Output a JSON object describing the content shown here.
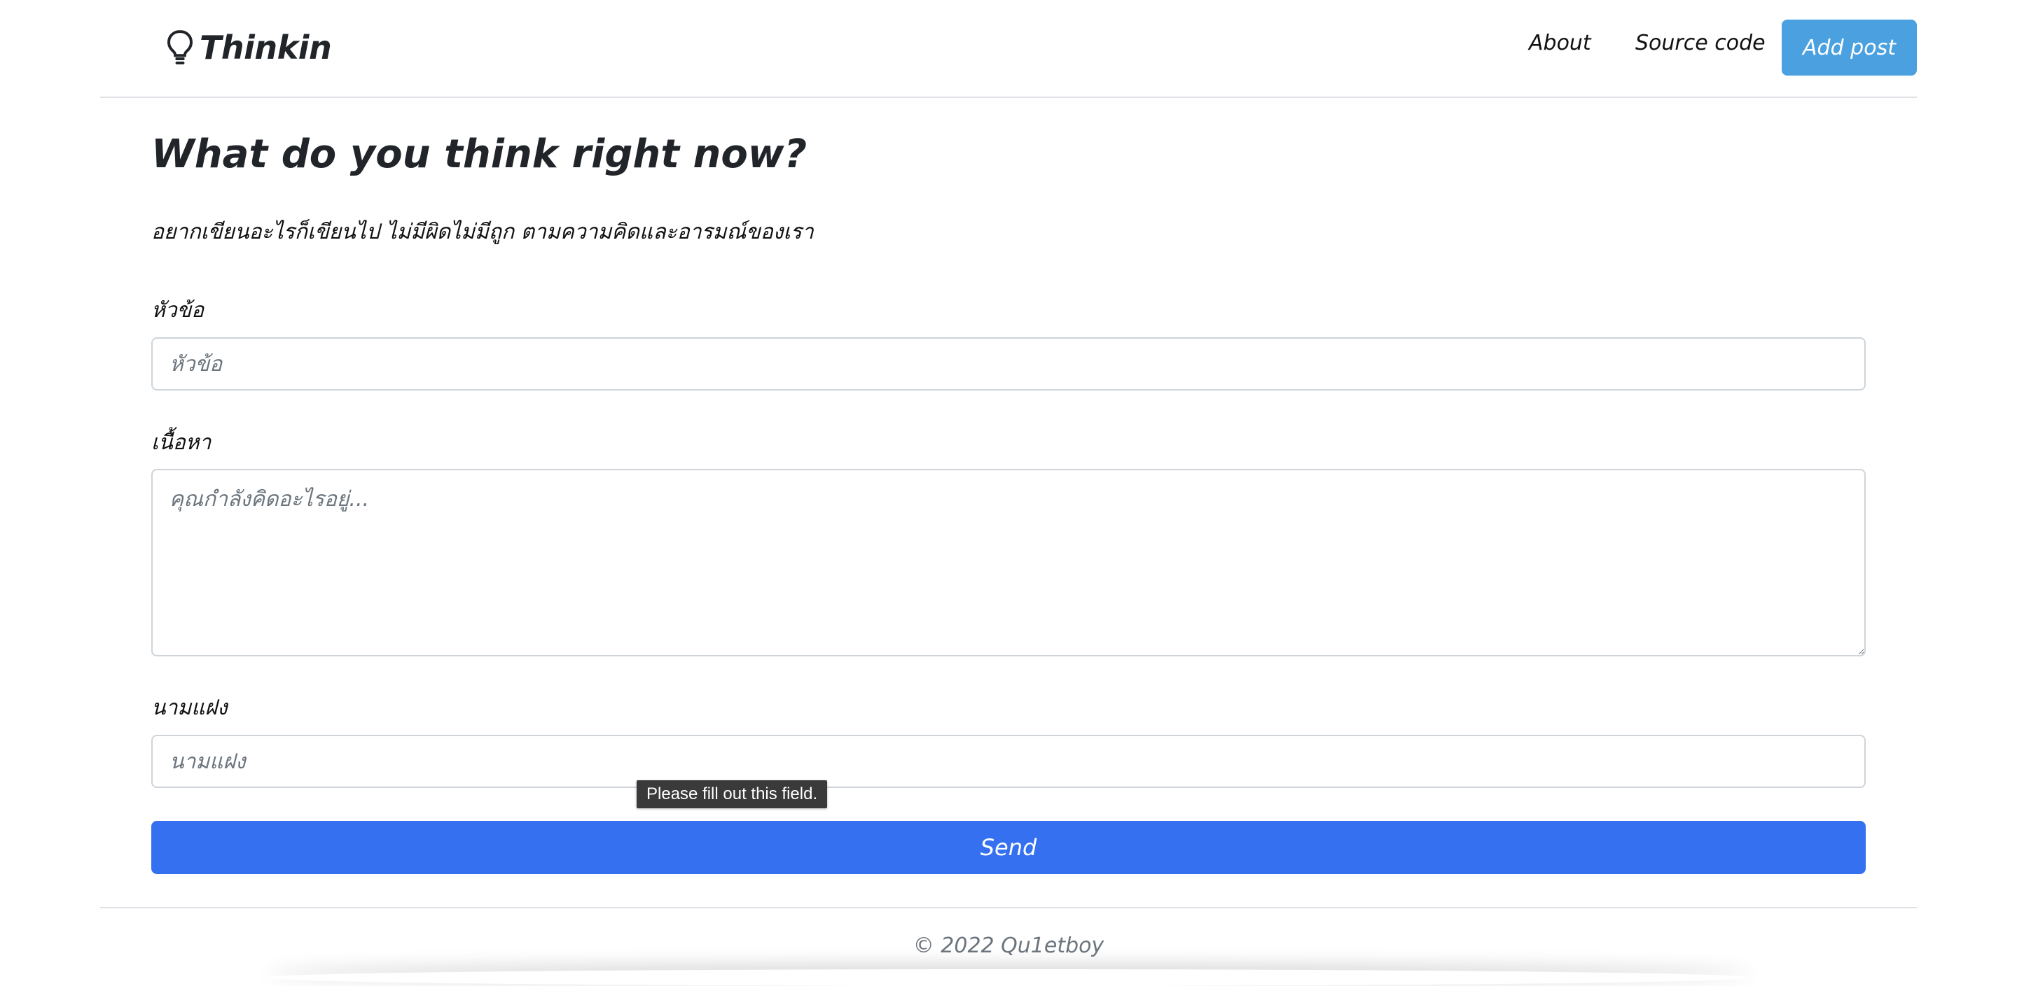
{
  "navbar": {
    "brand": "Thinkin",
    "links": {
      "about": "About",
      "source_code": "Source code"
    },
    "add_post": "Add post",
    "colors": {
      "add_post_bg": "#4ba1e0"
    }
  },
  "main": {
    "heading": "What do you think right now?",
    "subtitle": "อยากเขียนอะไรก็เขียนไป ไม่มีผิดไม่มีถูก ตามความคิดและอารมณ์ของเรา",
    "form": {
      "title_label": "หัวข้อ",
      "title_placeholder": "หัวข้อ",
      "title_value": "",
      "content_label": "เนื้อหา",
      "content_placeholder": "คุณกำลังคิดอะไรอยู่...",
      "content_value": "",
      "alias_label": "นามแฝง",
      "alias_placeholder": "นามแฝง",
      "alias_value": "",
      "validation_tooltip": "Please fill out this field.",
      "send": "Send",
      "colors": {
        "send_bg": "#3470f0"
      }
    }
  },
  "footer": {
    "text": "© 2022 Qu1etboy"
  },
  "icons": {
    "brand_icon": "lightbulb-icon"
  }
}
